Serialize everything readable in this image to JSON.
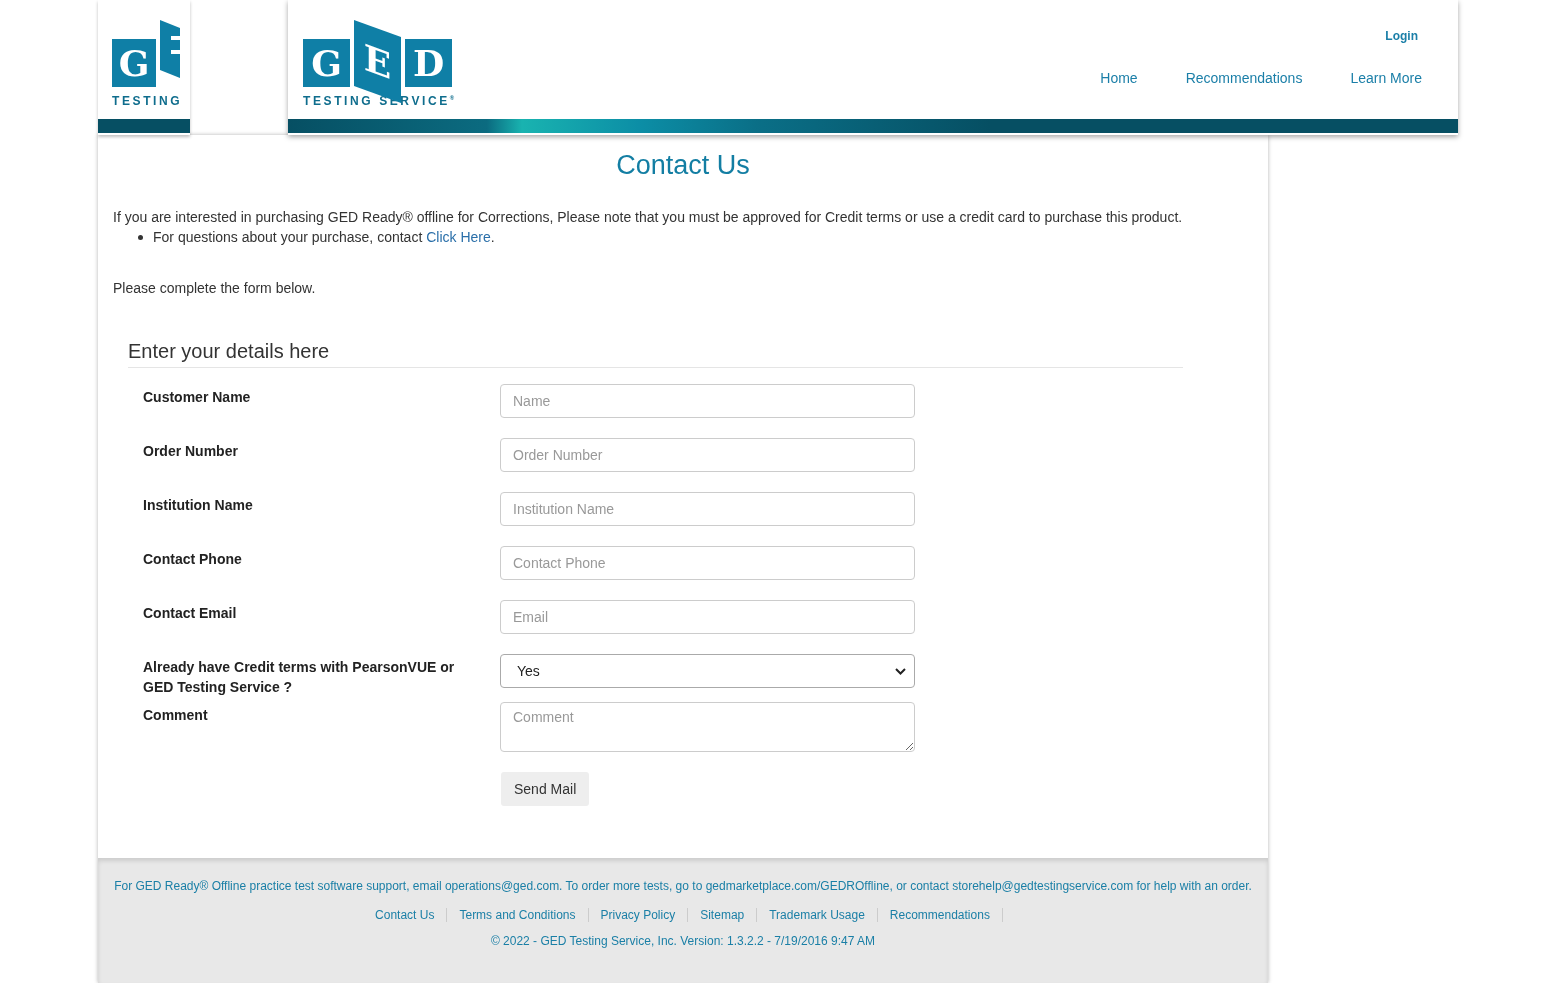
{
  "side_logo": {
    "letter": "G",
    "caption": "TESTING"
  },
  "logo": {
    "letters": [
      "G",
      "E",
      "D"
    ],
    "caption": "TESTING SERVICE",
    "mark": "®"
  },
  "login": "Login",
  "nav": [
    "Home",
    "Recommendations",
    "Learn More"
  ],
  "title": "Contact Us",
  "intro": "If you are interested in purchasing GED Ready® offline for Corrections, Please note that you must be approved for Credit terms or use a credit card to purchase this product.",
  "bullet": {
    "text": "For questions about your purchase, contact",
    "link": "Click Here",
    "end": "."
  },
  "instructions": "Please complete the form below.",
  "form": {
    "legend": "Enter your details here",
    "fields": [
      {
        "label": "Customer Name",
        "kind": "text",
        "placeholder": "Name"
      },
      {
        "label": "Order Number",
        "kind": "text",
        "placeholder": "Order Number"
      },
      {
        "label": "Institution Name",
        "kind": "text",
        "placeholder": "Institution Name"
      },
      {
        "label": "Contact Phone",
        "kind": "text",
        "placeholder": "Contact Phone"
      },
      {
        "label": "Contact Email",
        "kind": "text",
        "placeholder": "Email"
      },
      {
        "label": "Already have Credit terms with PearsonVUE or GED Testing Service ?",
        "kind": "select",
        "value": "Yes"
      },
      {
        "label": "Comment",
        "kind": "textarea",
        "placeholder": "Comment"
      }
    ],
    "submit": "Send Mail"
  },
  "footer": {
    "note": "For GED Ready® Offline practice test software support, email operations@ged.com. To order more tests, go to gedmarketplace.com/GEDROffline, or contact storehelp@gedtestingservice.com for help with an order.",
    "links": [
      "Contact Us",
      "Terms and Conditions",
      "Privacy Policy",
      "Sitemap",
      "Trademark Usage",
      "Recommendations"
    ],
    "copyright": "© 2022 - GED Testing Service, Inc. Version: 1.3.2.2 - 7/19/2016 9:47 AM"
  }
}
